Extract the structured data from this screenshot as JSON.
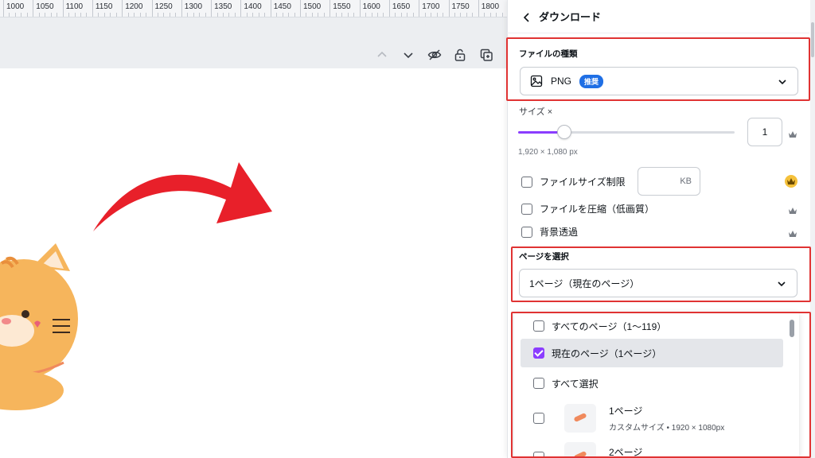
{
  "ruler": {
    "labels": [
      "1000",
      "1050",
      "1100",
      "1150",
      "1200",
      "1250",
      "1300",
      "1350",
      "1400",
      "1450",
      "1500",
      "1550",
      "1600",
      "1650",
      "1700",
      "1750",
      "1800"
    ]
  },
  "toolbar": {
    "icons": [
      "chevron-up-icon",
      "chevron-down-icon",
      "eye-icon",
      "lock-icon",
      "duplicate-icon"
    ]
  },
  "panel": {
    "title": "ダウンロード",
    "file_type": {
      "label": "ファイルの種類",
      "value": "PNG",
      "badge": "推奨"
    },
    "size": {
      "label": "サイズ ×",
      "value": "1",
      "dimensions": "1,920 × 1,080 px",
      "slider_fraction": 0.2
    },
    "options": [
      {
        "label": "ファイルサイズ制限",
        "checked": false,
        "unit": "KB"
      },
      {
        "label": "ファイルを圧縮（低画質）",
        "checked": false
      },
      {
        "label": "背景透過",
        "checked": false
      }
    ],
    "pages": {
      "label": "ページを選択",
      "selected": "1ページ（現在のページ）",
      "items": [
        {
          "label": "すべてのページ（1〜119）",
          "checked": false
        },
        {
          "label": "現在のページ（1ページ）",
          "checked": true
        },
        {
          "label": "すべて選択",
          "checked": false
        }
      ],
      "page_list": [
        {
          "name": "1ページ",
          "desc": "カスタムサイズ • 1920 × 1080px"
        },
        {
          "name": "2ページ",
          "desc": ""
        }
      ]
    }
  },
  "colors": {
    "accent": "#8b3dff",
    "highlight_box": "#e03333",
    "badge": "#1f6fe5",
    "arrow": "#e8202a",
    "cat": "#f6b55c"
  }
}
